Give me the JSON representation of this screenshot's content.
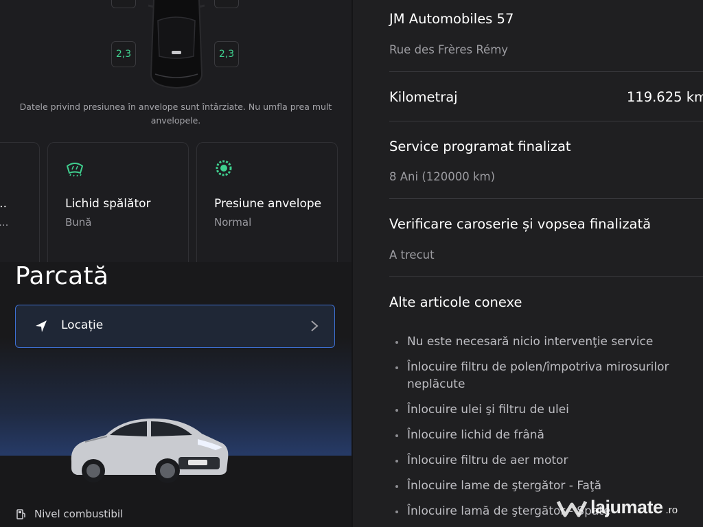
{
  "tire_pressure": {
    "rear_left": "2,3",
    "rear_right": "2,3",
    "note": "Datele privind presiunea în anvelope sunt întârziate. Nu umfla prea mult anvelopele."
  },
  "cards": [
    {
      "title": "",
      "status": "",
      "partial_title": "n...",
      "partial_status": "ţă..."
    },
    {
      "title": "Lichid spălător",
      "status": "Bună",
      "icon": "windshield-washer-icon"
    },
    {
      "title": "Presiune anvelope",
      "status": "Normal",
      "icon": "tire-pressure-icon"
    }
  ],
  "parked": {
    "title": "Parcată",
    "location_label": "Locație",
    "fuel_label": "Nivel combustibil"
  },
  "service": {
    "dealer_name": "JM Automobiles 57",
    "dealer_address": "Rue des Frères Rémy",
    "mileage_label": "Kilometraj",
    "mileage_value": "119.625 km",
    "scheduled_label": "Service programat finalizat",
    "scheduled_value": "8 Ani (120000 km)",
    "body_check_label": "Verificare caroserie și vopsea finalizată",
    "body_check_value": "A trecut",
    "related_label": "Alte articole conexe",
    "related_items": [
      "Nu este necesară nicio intervenţie service",
      "Înlocuire filtru de polen/împotriva mirosurilor neplăcute",
      "Înlocuire ulei şi filtru de ulei",
      "Înlocuire lichid de frână",
      "Înlocuire filtru de aer motor",
      "Înlocuire lame de ştergător - Faţă",
      "Înlocuire lamă de ştergător - Spate"
    ]
  },
  "watermark": {
    "name": "lajumate",
    "tld": ".ro"
  },
  "colors": {
    "accent_green": "#3fd08f",
    "location_border": "#3d6fd1"
  }
}
